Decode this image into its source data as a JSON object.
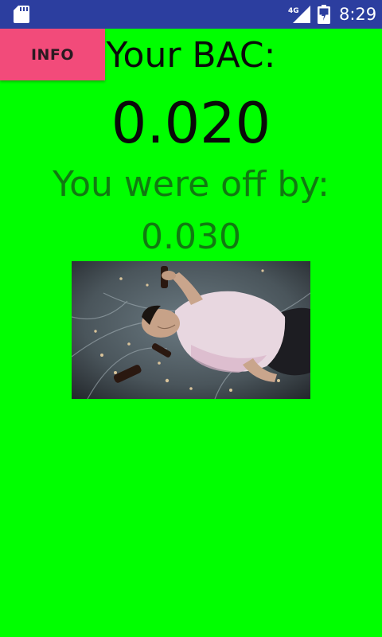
{
  "status_bar": {
    "time": "8:29",
    "network": "4G",
    "icons": [
      "sd-card-icon",
      "signal-icon",
      "battery-icon"
    ],
    "background_color": "#2c3e9f"
  },
  "info_button": {
    "label": "INFO",
    "color": "#f24b7a"
  },
  "bac": {
    "title": "Your BAC:",
    "value": "0.020"
  },
  "guess": {
    "label": "You were off by:",
    "value": "0.030"
  },
  "colors": {
    "background": "#00ff00",
    "primary_text": "#0a0a0a",
    "secondary_text": "#117a11"
  }
}
